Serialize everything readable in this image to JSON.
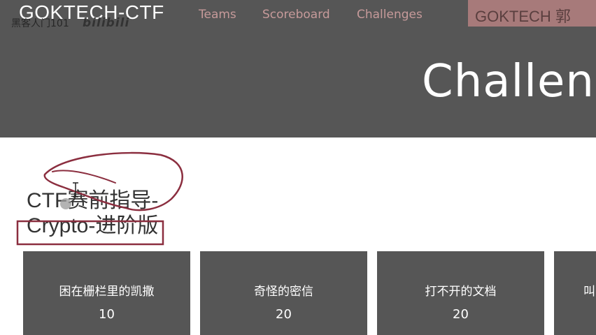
{
  "header": {
    "brand": "GOKTECH-CTF",
    "watermark": "黑客人门101",
    "bili_logo": "bilibili",
    "nav": [
      "Teams",
      "Scoreboard",
      "Challenges"
    ],
    "user_button": "GOKTECH 郭"
  },
  "hero": {
    "title": "Challen"
  },
  "category": {
    "title_line1": "CTF赛前指导-",
    "title_line2": "Crypto-进阶版"
  },
  "challenges": [
    {
      "name": "困在栅栏里的凯撒",
      "points": "10"
    },
    {
      "name": "奇怪的密信",
      "points": "20"
    },
    {
      "name": "打不开的文档",
      "points": "20"
    },
    {
      "name": "叫",
      "points": ""
    }
  ],
  "colors": {
    "hero_bg": "#565656",
    "nav_text": "#c69a9a",
    "annotation": "#8b2e3f",
    "card_bg": "#565656"
  }
}
